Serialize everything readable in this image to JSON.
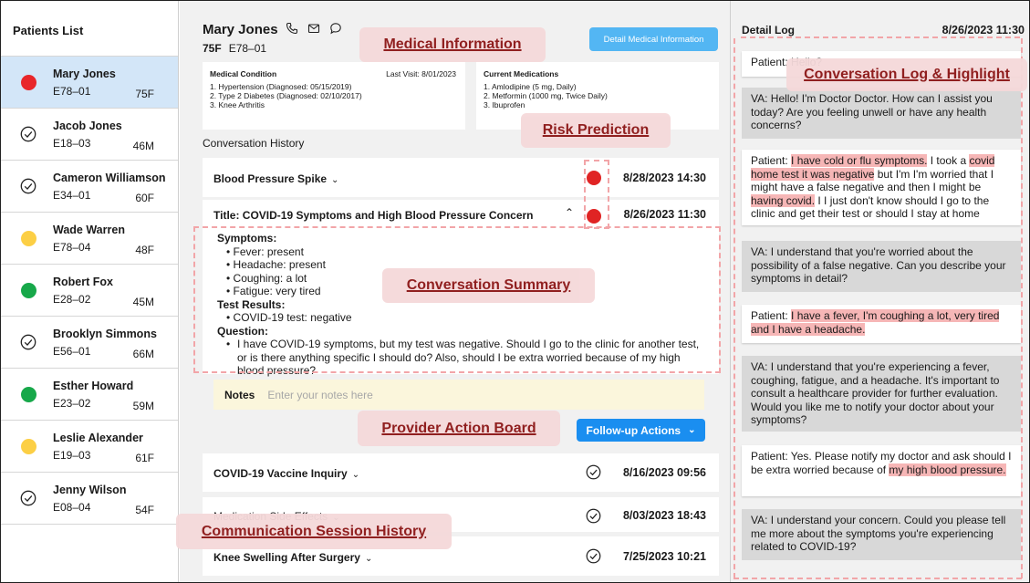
{
  "sidebar": {
    "title": "Patients List",
    "patients": [
      {
        "name": "Mary Jones",
        "id": "E78–01",
        "agesex": "75F",
        "status": "red",
        "selected": true
      },
      {
        "name": "Jacob Jones",
        "id": "E18–03",
        "agesex": "46M",
        "status": "check"
      },
      {
        "name": "Cameron Williamson",
        "id": "E34–01",
        "agesex": "60F",
        "status": "check"
      },
      {
        "name": "Wade Warren",
        "id": "E78–04",
        "agesex": "48F",
        "status": "yellow"
      },
      {
        "name": "Robert Fox",
        "id": "E28–02",
        "agesex": "45M",
        "status": "green"
      },
      {
        "name": "Brooklyn Simmons",
        "id": "E56–01",
        "agesex": "66M",
        "status": "check"
      },
      {
        "name": "Esther Howard",
        "id": "E23–02",
        "agesex": "59M",
        "status": "green"
      },
      {
        "name": "Leslie Alexander",
        "id": "E19–03",
        "agesex": "61F",
        "status": "yellow"
      },
      {
        "name": "Jenny Wilson",
        "id": "E08–04",
        "agesex": "54F",
        "status": "check"
      }
    ]
  },
  "colors": {
    "red": "#e8262a",
    "yellow": "#fccf45",
    "green": "#17a84a",
    "blue_btn": "#1a8ef0",
    "light_blue_btn": "#53b6f3",
    "selected_row": "#d3e6f8"
  },
  "header": {
    "name": "Mary Jones",
    "agesex": "75F",
    "id": "E78–01",
    "detail_button": "Detail Medical Information",
    "icons": [
      "phone-icon",
      "mail-icon",
      "chat-icon"
    ]
  },
  "medical": {
    "condition_title": "Medical Condition",
    "last_visit": "Last Visit: 8/01/2023",
    "conditions": [
      "1. Hypertension  (Diagnosed: 05/15/2019)",
      "2. Type 2 Diabetes (Diagnosed: 02/10/2017)",
      "3. Knee Arthritis"
    ],
    "medications_title": "Current Medications",
    "medications": [
      "1. Amlodipine (5 mg, Daily)",
      "2. Metformin (1000 mg, Twice Daily)",
      "3. Ibuprofen"
    ]
  },
  "conversation": {
    "title": "Conversation History",
    "sessions": [
      {
        "title": "Blood Pressure Spike",
        "date": "8/28/2023 14:30"
      },
      {
        "title": "Title: COVID-19 Symptoms and High Blood Pressure Concern",
        "date": "8/26/2023 11:30"
      },
      {
        "title": "COVID-19 Vaccine Inquiry",
        "date": "8/16/2023 09:56"
      },
      {
        "title": "Medication Side Effects",
        "date": "8/03/2023 18:43"
      },
      {
        "title": "Knee Swelling After Surgery",
        "date": "7/25/2023 10:21"
      }
    ],
    "summary": {
      "symptoms_label": "Symptoms:",
      "symptoms": [
        "• Fever: present",
        "• Headache: present",
        "• Coughing: a lot",
        "• Fatigue: very tired"
      ],
      "tests_label": "Test Results:",
      "tests": [
        "• COVID-19 test: negative"
      ],
      "question_label": "Question:",
      "question": "I have COVID-19 symptoms, but my test was negative. Should I go to the clinic for another test, or is there anything specific I should do? Also, should I be extra worried because of my high blood pressure?"
    },
    "notes_label": "Notes",
    "notes_placeholder": "Enter your notes here",
    "followup_button": "Follow-up Actions"
  },
  "log": {
    "title": "Detail Log",
    "date": "8/26/2023 11:30",
    "messages": [
      {
        "type": "patient",
        "text": "Patient: Hello?"
      },
      {
        "type": "va",
        "text": "VA: Hello! I'm Doctor Doctor. How can I assist you today? Are you feeling unwell or have any health concerns?"
      },
      {
        "type": "patient",
        "p1": "Patient: ",
        "h1": "I have cold or flu symptoms.",
        "p2": " I took a ",
        "h2": "covid home test it was negative",
        "p3": " but I'm I'm worried that I might have a false negative and then I might be ",
        "h3": "having covid.",
        "p4": " I I just don't know should I go to the clinic and get their test or should I stay at home"
      },
      {
        "type": "va",
        "text": "VA: I understand that you're worried about the possibility of a false negative. Can you describe your symptoms in detail?"
      },
      {
        "type": "patient",
        "p1": "Patient: ",
        "h1": "I have a fever, I'm coughing a lot, very tired and I have a headache."
      },
      {
        "type": "va",
        "text": "VA: I understand that you're experiencing a fever, coughing, fatigue, and a headache. It's important to consult a healthcare provider for further evaluation. Would you like me to notify your doctor about your symptoms?"
      },
      {
        "type": "patient",
        "p1": "Patient: Yes. Please notify my doctor and ask should I be extra worried because of ",
        "h1": "my high blood pressure."
      },
      {
        "type": "va",
        "text": "VA: I understand your concern. Could you please tell me more about the symptoms you're experiencing related to COVID-19?"
      }
    ]
  },
  "annotations": {
    "medical_information": "Medical Information",
    "risk_prediction": "Risk Prediction",
    "conversation_summary": "Conversation Summary",
    "provider_action_board": "Provider Action Board",
    "communication_session_history": "Communication Session History",
    "conversation_log": "Conversation Log & Highlight"
  }
}
